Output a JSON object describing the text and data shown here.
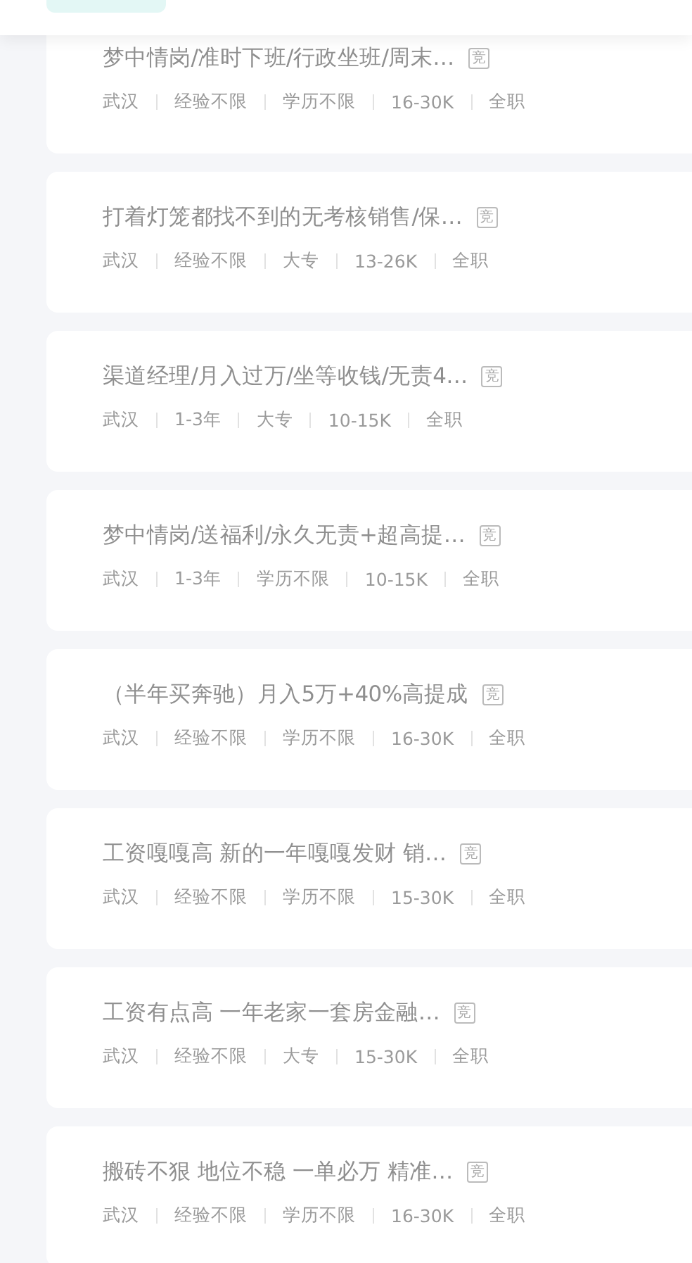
{
  "jobs": [
    {
      "title": "梦中情岗/准时下班/行政坐班/周末…",
      "badge": "竞",
      "meta": [
        "武汉",
        "经验不限",
        "学历不限",
        "16-30K",
        "全职"
      ]
    },
    {
      "title": "打着灯笼都找不到的无考核销售/保…",
      "badge": "竞",
      "meta": [
        "武汉",
        "经验不限",
        "大专",
        "13-26K",
        "全职"
      ]
    },
    {
      "title": "渠道经理/月入过万/坐等收钱/无责4…",
      "badge": "竞",
      "meta": [
        "武汉",
        "1-3年",
        "大专",
        "10-15K",
        "全职"
      ]
    },
    {
      "title": "梦中情岗/送福利/永久无责+超高提…",
      "badge": "竞",
      "meta": [
        "武汉",
        "1-3年",
        "学历不限",
        "10-15K",
        "全职"
      ]
    },
    {
      "title": "（半年买奔驰）月入5万+40%高提成",
      "badge": "竞",
      "meta": [
        "武汉",
        "经验不限",
        "学历不限",
        "16-30K",
        "全职"
      ]
    },
    {
      "title": "工资嘎嘎高 新的一年嘎嘎发财 销…",
      "badge": "竞",
      "meta": [
        "武汉",
        "经验不限",
        "学历不限",
        "15-30K",
        "全职"
      ]
    },
    {
      "title": "工资有点高 一年老家一套房金融…",
      "badge": "竞",
      "meta": [
        "武汉",
        "经验不限",
        "大专",
        "15-30K",
        "全职"
      ]
    },
    {
      "title": "搬砖不狠 地位不稳 一单必万 精准…",
      "badge": "竞",
      "meta": [
        "武汉",
        "经验不限",
        "学历不限",
        "16-30K",
        "全职"
      ]
    }
  ]
}
